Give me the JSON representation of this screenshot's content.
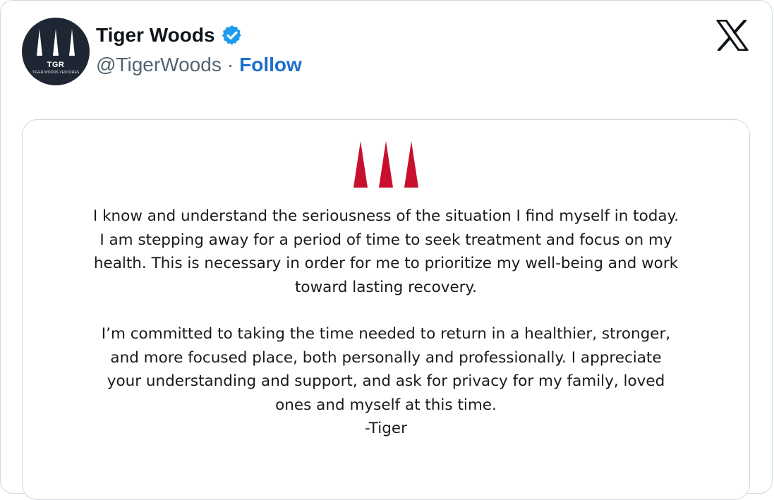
{
  "author": {
    "display_name": "Tiger Woods",
    "handle": "@TigerWoods",
    "separator": "·",
    "follow_label": "Follow",
    "verified": true,
    "avatar": {
      "monogram": "TGR",
      "subtitle": "TIGER WOODS VENTURES"
    }
  },
  "platform": {
    "logo": "x-logo-icon"
  },
  "statement": {
    "logo": "tgr-trees-icon",
    "paragraph1_lines": [
      "I know and understand the seriousness of the situation I find myself in today.",
      "I am stepping away for a period of time to seek treatment and focus on my",
      "health. This is necessary in order for me to prioritize my well-being and work",
      "toward lasting recovery."
    ],
    "paragraph2_lines": [
      "I’m committed to taking the time needed to return in a healthier, stronger,",
      "and more focused place, both personally and professionally. I appreciate",
      "your understanding and support, and ask for privacy for my family, loved",
      "ones and myself at this time."
    ],
    "signature": "-Tiger"
  },
  "colors": {
    "verified_blue": "#1d9bf0",
    "follow_blue": "#1d6fc9",
    "logo_red": "#c8102e",
    "avatar_bg": "#1f2633"
  }
}
